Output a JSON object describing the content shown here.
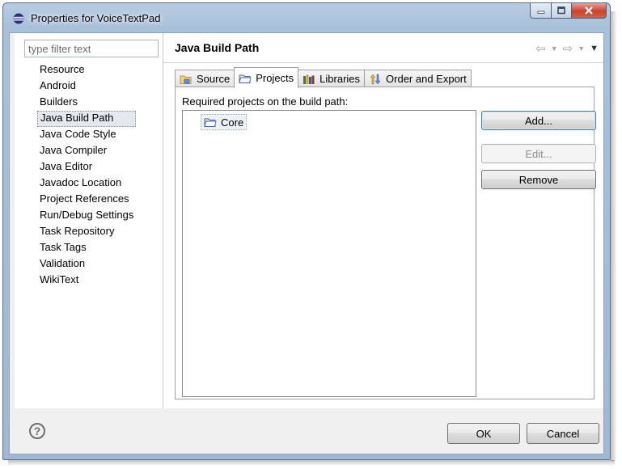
{
  "window": {
    "title": "Properties for VoiceTextPad"
  },
  "filter": {
    "placeholder": "type filter text"
  },
  "tree": {
    "items": [
      "Resource",
      "Android",
      "Builders",
      "Java Build Path",
      "Java Code Style",
      "Java Compiler",
      "Java Editor",
      "Javadoc Location",
      "Project References",
      "Run/Debug Settings",
      "Task Repository",
      "Task Tags",
      "Validation",
      "WikiText"
    ],
    "selected": "Java Build Path"
  },
  "page": {
    "title": "Java Build Path"
  },
  "tabs": [
    {
      "label": "Source"
    },
    {
      "label": "Projects"
    },
    {
      "label": "Libraries"
    },
    {
      "label": "Order and Export"
    }
  ],
  "active_tab": "Projects",
  "projects": {
    "label": "Required projects on the build path:",
    "items": [
      "Core"
    ]
  },
  "buttons": {
    "add": "Add...",
    "edit": "Edit...",
    "remove": "Remove"
  },
  "footer": {
    "ok": "OK",
    "cancel": "Cancel",
    "help": "?"
  },
  "colors": {
    "accent": "#3c7fb1",
    "title_bar": "#a9c0da",
    "close_button": "#c9412d"
  }
}
